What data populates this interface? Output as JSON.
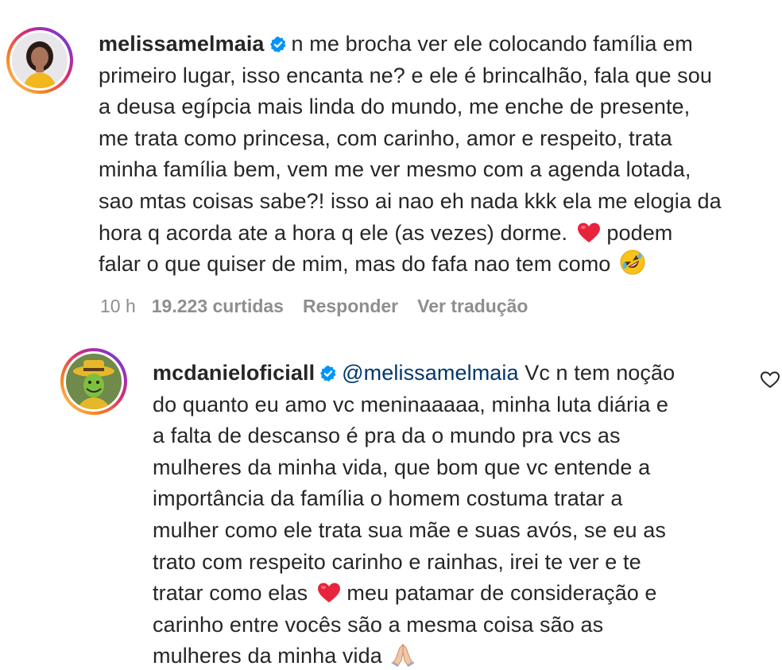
{
  "comments": [
    {
      "username": "melissamelmaia",
      "verified": true,
      "lines": [
        "n me brocha ver ele colocando família em",
        "primeiro lugar, isso encanta ne? e ele é brincalhão, fala que sou",
        "a deusa egípcia mais linda do mundo, me enche de presente,",
        "me trata como princesa, com carinho, amor e respeito, trata",
        "minha família bem, vem me ver mesmo com a agenda lotada,",
        "sao mtas coisas sabe?! isso ai nao eh nada kkk ela me elogia da",
        "hora q acorda ate a hora q ele (as vezes) dorme.",
        "podem",
        "falar o que quiser de mim, mas do fafa nao tem como"
      ],
      "emojis": [
        "red-heart",
        "rolling-laughing-face"
      ],
      "meta": {
        "time": "10 h",
        "likes": "19.223 curtidas",
        "reply_label": "Responder",
        "translate_label": "Ver tradução"
      }
    },
    {
      "username": "mcdanieloficiall",
      "verified": true,
      "mention": "@melissamelmaia",
      "lines": [
        "Vc n tem noção",
        "do quanto eu amo vc meninaaaaa, minha luta diária e",
        "a falta de descanso é pra da o mundo pra vcs as",
        "mulheres da minha vida, que bom que vc entende a",
        "importância da família o homem costuma tratar a",
        "mulher como ele trata sua mãe e suas avós, se eu as",
        "trato com respeito carinho e rainhas, irei te ver e te",
        "tratar como elas",
        "meu patamar de consideração e",
        "carinho entre vocês são a mesma coisa são as",
        "mulheres da minha vida"
      ],
      "emojis": [
        "red-heart",
        "folded-hands"
      ],
      "like_icon": "heart-outline-icon"
    }
  ],
  "colors": {
    "text": "#262626",
    "meta": "#8e8e8e",
    "verified": "#0095f6",
    "mention": "#00376b",
    "heart": "#ed1c3a"
  }
}
